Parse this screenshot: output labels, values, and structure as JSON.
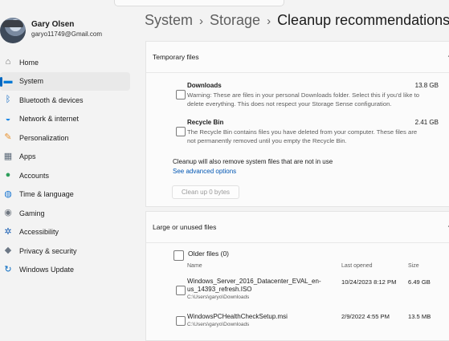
{
  "user": {
    "name": "Gary Olsen",
    "email": "garyo11749@Gmail.com"
  },
  "sidebar": {
    "items": [
      {
        "label": "Home",
        "icon": "home-icon",
        "glyph": "⌂",
        "color": "#6b6b6b"
      },
      {
        "label": "System",
        "icon": "monitor-icon",
        "glyph": "▬",
        "color": "#0078d4"
      },
      {
        "label": "Bluetooth & devices",
        "icon": "bluetooth-icon",
        "glyph": "ᛒ",
        "color": "#0a66c2"
      },
      {
        "label": "Network & internet",
        "icon": "wifi-icon",
        "glyph": "◒",
        "color": "#1e88e5"
      },
      {
        "label": "Personalization",
        "icon": "brush-icon",
        "glyph": "✎",
        "color": "#e8912d"
      },
      {
        "label": "Apps",
        "icon": "apps-icon",
        "glyph": "▦",
        "color": "#5d6b7a"
      },
      {
        "label": "Accounts",
        "icon": "account-icon",
        "glyph": "●",
        "color": "#2e9e5b"
      },
      {
        "label": "Time & language",
        "icon": "globe-icon",
        "glyph": "◍",
        "color": "#1976d2"
      },
      {
        "label": "Gaming",
        "icon": "controller-icon",
        "glyph": "◉",
        "color": "#6f7680"
      },
      {
        "label": "Accessibility",
        "icon": "accessibility-icon",
        "glyph": "✲",
        "color": "#1a5fb4"
      },
      {
        "label": "Privacy & security",
        "icon": "shield-icon",
        "glyph": "◆",
        "color": "#6c7785"
      },
      {
        "label": "Windows Update",
        "icon": "update-icon",
        "glyph": "↻",
        "color": "#0067c0"
      }
    ],
    "active_index": 1
  },
  "breadcrumb": {
    "part1": "System",
    "part2": "Storage",
    "current": "Cleanup recommendations",
    "separator": "›"
  },
  "temp_files": {
    "header": "Temporary files",
    "items": [
      {
        "title": "Downloads",
        "size": "13.8 GB",
        "desc_line1": "Warning: These are files in your personal Downloads folder. Select this if you'd like to",
        "desc_line2": "delete everything. This does not respect your Storage Sense configuration."
      },
      {
        "title": "Recycle Bin",
        "size": "2.41 GB",
        "desc_line1": "The Recycle Bin contains files you have deleted from your computer. These files are",
        "desc_line2": "not permanently removed until you empty the Recycle Bin."
      }
    ],
    "also_text": "Cleanup will also remove system files that are not in use",
    "advanced_link": "See advanced options",
    "cleanup_button": "Clean up 0 bytes"
  },
  "large_files": {
    "header": "Large or unused files",
    "group_label": "Older files (0)",
    "columns": {
      "name": "Name",
      "last_opened": "Last opened",
      "size": "Size"
    },
    "rows": [
      {
        "name_line1": "Windows_Server_2016_Datacenter_EVAL_en-",
        "name_line2": "us_14393_refresh.ISO",
        "path": "C:\\Users\\garyo\\Downloads",
        "last_opened": "10/24/2023 8:12 PM",
        "size": "6.49 GB"
      },
      {
        "name_line1": "WindowsPCHealthCheckSetup.msi",
        "name_line2": "",
        "path": "C:\\Users\\garyo\\Downloads",
        "last_opened": "2/9/2022 4:55 PM",
        "size": "13.5 MB"
      }
    ]
  },
  "colors": {
    "accent": "#0067c0",
    "link": "#0056b3"
  }
}
